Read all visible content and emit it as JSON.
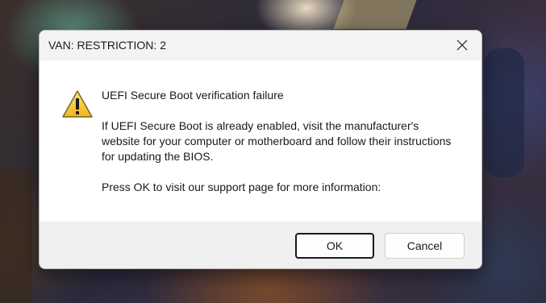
{
  "dialog": {
    "title": "VAN: RESTRICTION: 2",
    "heading": "UEFI Secure Boot verification failure",
    "body": "If UEFI Secure Boot is already enabled, visit the manufacturer's website for your computer or motherboard and follow their instructions for updating the BIOS.",
    "prompt": "Press OK to visit our support page for more information:",
    "icon": "warning-icon",
    "ok_label": "OK",
    "cancel_label": "Cancel",
    "close_icon": "close-icon"
  },
  "colors": {
    "warning_fill": "#f7c928",
    "warning_border": "#6b5a1e",
    "footer_bg": "#f0f0f0",
    "titlebar_bg": "#f3f3f3"
  }
}
